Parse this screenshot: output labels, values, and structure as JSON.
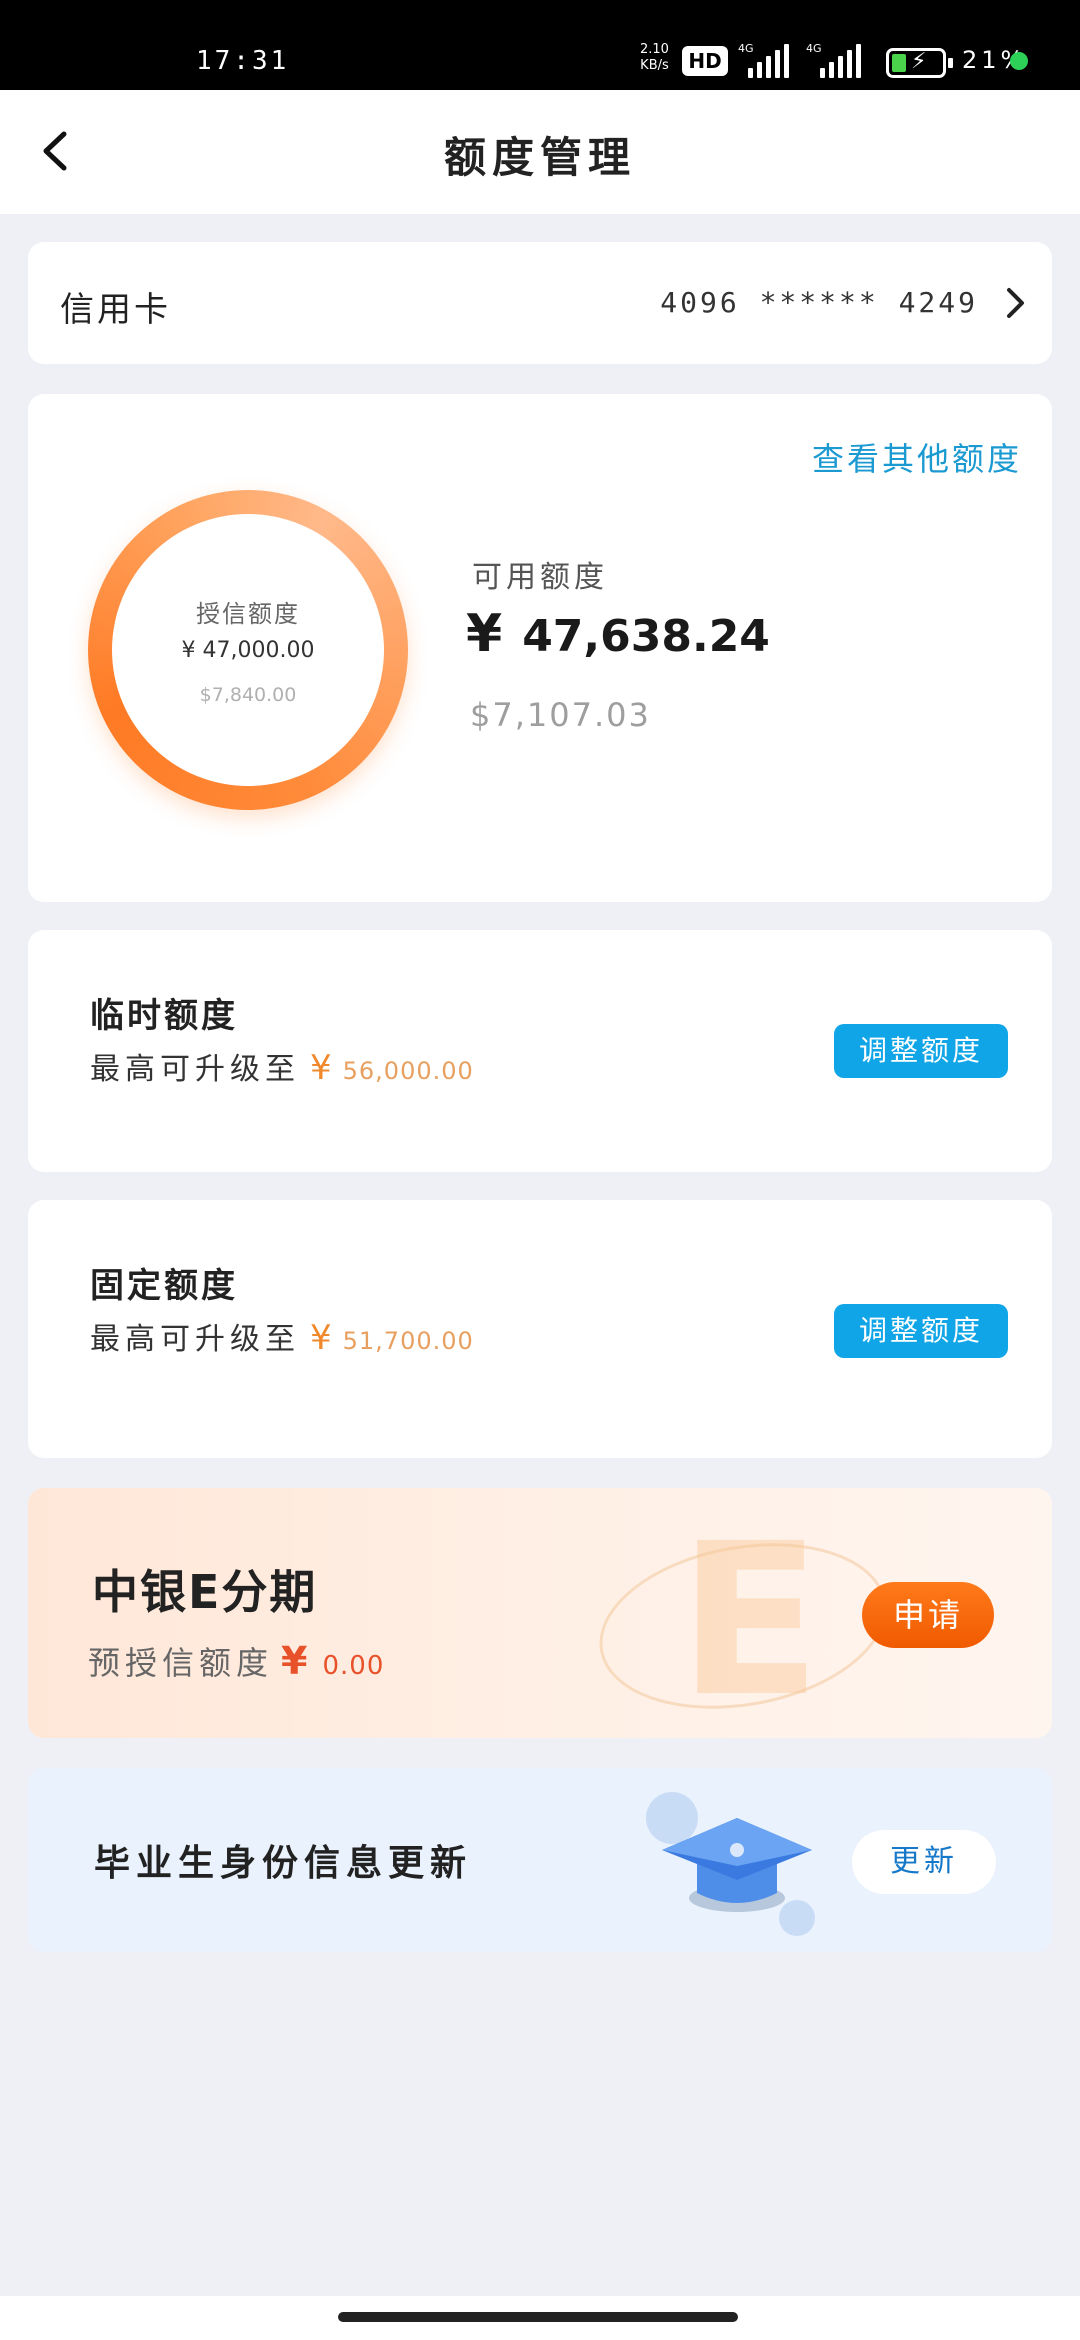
{
  "status_bar": {
    "time": "17:31",
    "net_speed_value": "2.10",
    "net_speed_unit": "KB/s",
    "hd_label": "HD",
    "signal1_tag": "4G",
    "signal2_tag": "4G",
    "battery_percent": "21%"
  },
  "header": {
    "title": "额度管理"
  },
  "credit_card": {
    "label": "信用卡",
    "number": "4096  ******  4249"
  },
  "available": {
    "other_link": "查看其他额度",
    "ring_label": "授信额度",
    "ring_cny": "¥ 47,000.00",
    "ring_usd": "$7,840.00",
    "label": "可用额度",
    "yen": "¥",
    "amount_cny": "47,638.24",
    "amount_usd": "$7,107.03"
  },
  "temporary_limit": {
    "name": "临时额度",
    "desc": "最高可升级至",
    "yen": "¥",
    "amount": "56,000.00",
    "button": "调整额度"
  },
  "fixed_limit": {
    "name": "固定额度",
    "desc": "最高可升级至",
    "yen": "¥",
    "amount": "51,700.00",
    "button": "调整额度"
  },
  "installment": {
    "title": "中银E分期",
    "sub": "预授信额度",
    "yen": "¥",
    "amount": "0.00",
    "deco_letter": "E",
    "button": "申请"
  },
  "graduate": {
    "title": "毕业生身份信息更新",
    "button": "更新"
  },
  "colors": {
    "accent_blue": "#10a5e6",
    "link_blue": "#1b9ad2",
    "orange": "#ff7a24",
    "apply_orange": "#f05a00"
  }
}
